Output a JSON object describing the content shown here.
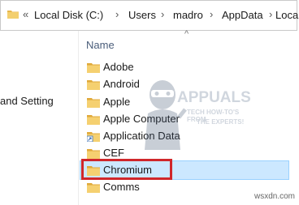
{
  "address_bar": {
    "nav_chevron": "«",
    "segments": [
      "Local Disk (C:)",
      "Users",
      "madro",
      "AppData",
      "Local"
    ],
    "separator": "›"
  },
  "left_pane": {
    "text": "and Setting"
  },
  "columns": {
    "name_label": "Name",
    "sort_indicator": "^"
  },
  "files": [
    {
      "name": "Adobe",
      "icon": "folder-icon"
    },
    {
      "name": "Android",
      "icon": "folder-icon"
    },
    {
      "name": "Apple",
      "icon": "folder-icon"
    },
    {
      "name": "Apple Computer",
      "icon": "folder-icon"
    },
    {
      "name": "Application Data",
      "icon": "shortcut-folder-icon"
    },
    {
      "name": "CEF",
      "icon": "folder-icon"
    },
    {
      "name": "Chromium",
      "icon": "folder-icon",
      "selected": true
    },
    {
      "name": "Comms",
      "icon": "folder-icon"
    }
  ],
  "watermark": {
    "brand": "APPUALS",
    "tagline1": "TECH HOW-TO'S FROM",
    "tagline2": "THE EXPERTS!"
  },
  "credit": "wsxdn.com",
  "colors": {
    "highlight": "#d0272b",
    "selection": "#cce8ff",
    "folder": "#e8b64a"
  }
}
